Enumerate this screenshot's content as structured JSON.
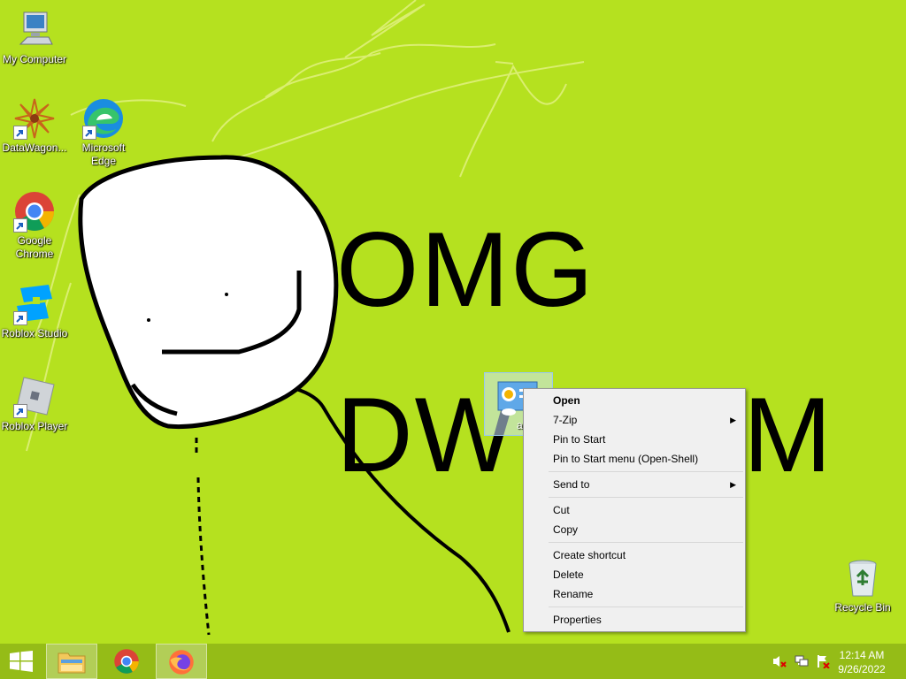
{
  "desktop": {
    "wallpaper_text_line1": "OMG",
    "wallpaper_text_line2": "DW",
    "wallpaper_text_line2_tail": "M",
    "icons": [
      {
        "label": "My Computer",
        "icon": "computer-icon"
      },
      {
        "label": "DataWagon...",
        "icon": "datawagon-icon"
      },
      {
        "label": "Microsoft Edge",
        "icon": "edge-icon"
      },
      {
        "label": "Google Chrome",
        "icon": "chrome-icon"
      },
      {
        "label": "Roblox Studio",
        "icon": "roblox-studio-icon"
      },
      {
        "label": "Roblox Player",
        "icon": "roblox-player-icon"
      },
      {
        "label": "Recycle Bin",
        "icon": "recycle-bin-icon"
      }
    ],
    "selected_icon_label": "a"
  },
  "context_menu": {
    "items": [
      {
        "label": "Open",
        "bold": true
      },
      {
        "label": "7-Zip",
        "submenu": true
      },
      {
        "label": "Pin to Start"
      },
      {
        "label": "Pin to Start menu (Open-Shell)"
      },
      {
        "label": "Send to",
        "submenu": true
      },
      {
        "label": "Cut"
      },
      {
        "label": "Copy"
      },
      {
        "label": "Create shortcut"
      },
      {
        "label": "Delete"
      },
      {
        "label": "Rename"
      },
      {
        "label": "Properties"
      }
    ],
    "submenu_arrow": "▶"
  },
  "taskbar": {
    "pinned": [
      "file-explorer-icon",
      "chrome-icon",
      "firefox-icon"
    ],
    "tray_icons": [
      "volume-muted-icon",
      "network-icon",
      "action-center-flag-icon"
    ],
    "time": "12:14 AM",
    "date": "9/26/2022"
  },
  "colors": {
    "wallpaper": "#b5e11f",
    "taskbar": "#95bc17"
  }
}
